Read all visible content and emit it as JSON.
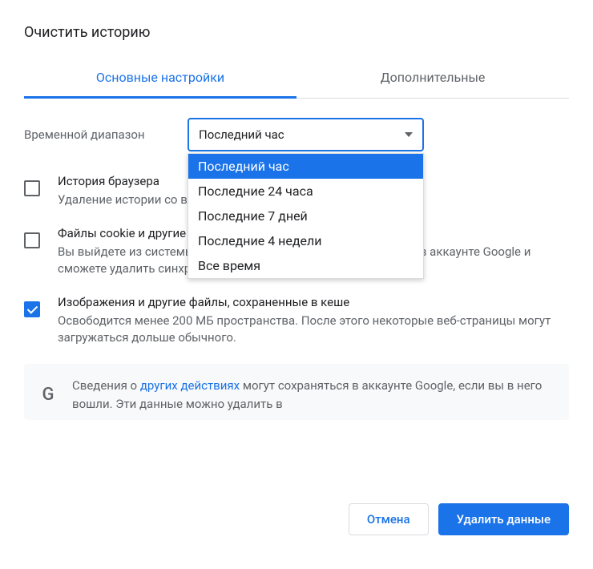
{
  "title": "Очистить историю",
  "tabs": {
    "basic": "Основные настройки",
    "advanced": "Дополнительные"
  },
  "timeRange": {
    "label": "Временной диапазон",
    "selected": "Последний час",
    "options": {
      "hour": "Последний час",
      "day": "Последние 24 часа",
      "week": "Последние 7 дней",
      "month": "Последние 4 недели",
      "all": "Все время"
    }
  },
  "items": {
    "history": {
      "title": "История браузера",
      "desc": "Удаление истории со всех синхронизированных устройствах",
      "checked": false
    },
    "cookies": {
      "title": "Файлы cookie и другие данные сайтов",
      "desc": "Вы выйдете из системы на большинстве сайтов, но останетесь в аккаунте Google и сможете удалить синхронизированные данные.",
      "checked": false
    },
    "cache": {
      "title": "Изображения и другие файлы, сохраненные в кеше",
      "desc": "Освободится менее 200 МБ пространства. После этого некоторые веб-страницы могут загружаться дольше обычного.",
      "checked": true
    }
  },
  "info": {
    "prefix": "Сведения о ",
    "link": "других действиях",
    "suffix": " могут сохраняться в аккаунте Google, если вы в него вошли. Эти данные можно удалить в"
  },
  "buttons": {
    "cancel": "Отмена",
    "clear": "Удалить данные"
  }
}
